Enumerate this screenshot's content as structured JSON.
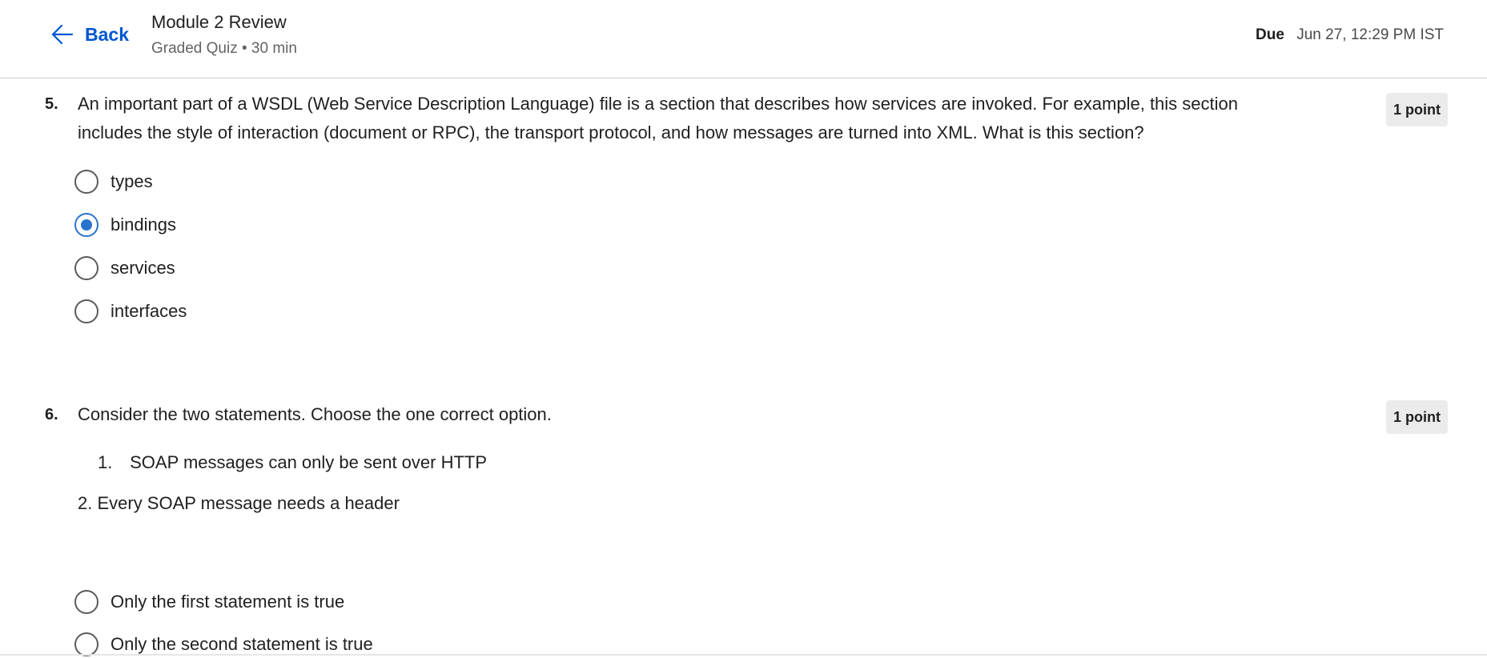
{
  "header": {
    "back_label": "Back",
    "title": "Module 2 Review",
    "subtitle": "Graded Quiz • 30 min",
    "due_label": "Due",
    "due_value": "Jun 27, 12:29 PM IST"
  },
  "questions": [
    {
      "number": "5.",
      "text": "An important part of a WSDL (Web Service Description Language) file is a section that describes how services are invoked. For example, this section includes the style of interaction (document or RPC), the transport protocol, and how messages are turned into XML. What is this section?",
      "points": "1 point",
      "options": [
        {
          "label": "types",
          "selected": false
        },
        {
          "label": "bindings",
          "selected": true
        },
        {
          "label": "services",
          "selected": false
        },
        {
          "label": "interfaces",
          "selected": false
        }
      ]
    },
    {
      "number": "6.",
      "text": "Consider the two statements. Choose the one correct option.",
      "points": "1 point",
      "statements": [
        {
          "number": "1.",
          "text": "SOAP messages can only be sent over HTTP"
        },
        {
          "text": "2. Every SOAP message needs a header"
        }
      ],
      "options": [
        {
          "label": "Only the first statement is true",
          "selected": false
        },
        {
          "label": "Only the second statement is true",
          "selected": false
        }
      ]
    }
  ],
  "colors": {
    "accent": "#0056d2",
    "radio_selected": "#2a73cc",
    "badge_bg": "#ebebeb",
    "text": "#1f1f1f",
    "muted": "#636363"
  },
  "icons": {
    "back": "arrow-left-icon"
  }
}
